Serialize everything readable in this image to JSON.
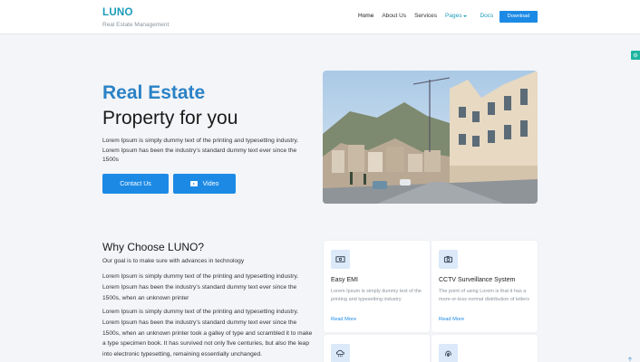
{
  "header": {
    "brand": "LUNO",
    "tagline": "Real Estate Management",
    "nav": [
      "Home",
      "About Us",
      "Services",
      "Pages",
      "Docs"
    ],
    "download": "Download"
  },
  "hero": {
    "title_accent": "Real Estate",
    "title": "Property for you",
    "description": "Lorem Ipsum is simply dummy text of the printing and typesetting industry. Lorem Ipsum has been the industry's standard dummy text ever since the 1500s",
    "contact_button": "Contact Us",
    "video_button": "Video"
  },
  "why": {
    "title": "Why Choose LUNO?",
    "subtitle": "Our goal is to make sure with advances in technology",
    "p1": "Lorem Ipsum is simply dummy text of the printing and typesetting industry. Lorem Ipsum has been the industry's standard dummy text ever since the 1500s, when an unknown printer",
    "p2": "Lorem Ipsum is simply dummy text of the printing and typesetting industry. Lorem Ipsum has been the industry's standard dummy text ever since the 1500s, when an unknown printer took a galley of type and scrambled it to make a type specimen book. It has survived not only five centuries, but also the leap into electronic typesetting, remaining essentially unchanged."
  },
  "cards": [
    {
      "title": "Easy EMI",
      "text": "Lorem Ipsum is simply dummy text of the printing and typesetting industry",
      "link": "Read More"
    },
    {
      "title": "CCTV Surveillance System",
      "text": "The point of using Lorem is that it has a more-or-less normal distribution of letters",
      "link": "Read More"
    }
  ],
  "colors": {
    "accent": "#1c8ae5",
    "brand": "#1a9bb8",
    "heading_accent": "#2b82c6"
  }
}
